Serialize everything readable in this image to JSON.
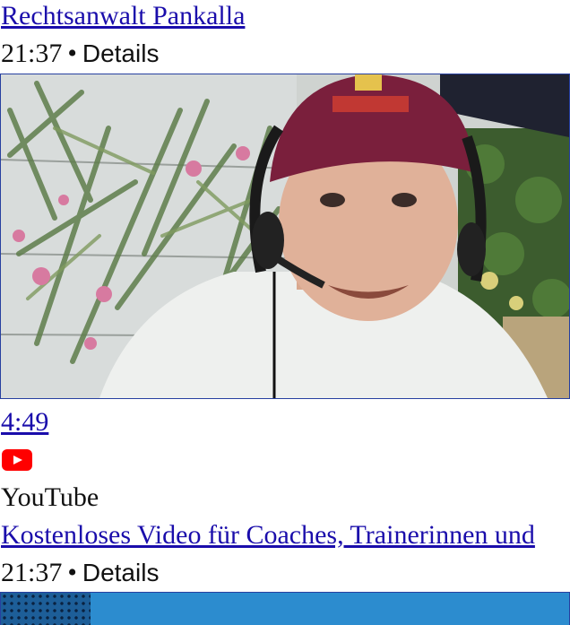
{
  "item1": {
    "title": "Rechtsanwalt Pankalla",
    "time": "21:37",
    "separator": "•",
    "details": "Details"
  },
  "video": {
    "duration": "4:49",
    "source_icon": "youtube-icon",
    "source": "YouTube",
    "title": "Kostenloses Video für Coaches, Trainerinnen und",
    "time": "21:37",
    "separator": "•",
    "details": "Details"
  },
  "colors": {
    "link": "#1a0dab",
    "border": "#2740a0",
    "youtube_red": "#ff0000"
  }
}
